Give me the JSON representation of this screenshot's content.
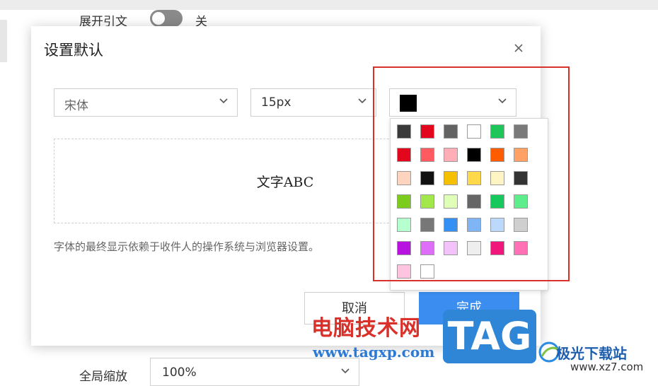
{
  "background": {
    "expand_quote_label": "展开引文",
    "expand_quote_state": "关",
    "global_zoom_label": "全局缩放",
    "global_zoom_value": "100%"
  },
  "dialog": {
    "title": "设置默认",
    "font_family": "宋体",
    "font_size": "15px",
    "selected_color": "#000000",
    "preview_text": "文字ABC",
    "note": "字体的最终显示依赖于收件人的操作系统与浏览器设置。",
    "cancel_label": "取消",
    "done_label": "完成"
  },
  "color_palette": [
    [
      "#3a3a3a",
      "#e3071e",
      "#636363",
      "#ffffff",
      "#1ec65a",
      "#7a7a7a"
    ],
    [
      "#e3071e",
      "#ff5a5f",
      "#ffadb7",
      "#000000",
      "#ff5b00",
      "#ffa165"
    ],
    [
      "#ffd4bf",
      "#111111",
      "#f5c000",
      "#ffd94a",
      "#fff4c4",
      "#333333"
    ],
    [
      "#7ccc1e",
      "#a3e84b",
      "#dfffb8",
      "#666666",
      "#17c85c",
      "#5eed8b"
    ],
    [
      "#b6ffcf",
      "#777777",
      "#3490f3",
      "#7fb4f5",
      "#bcd9fb",
      "#cfcfcf"
    ],
    [
      "#b712e0",
      "#de6df7",
      "#f3c2fb",
      "#eeeeee",
      "#f0167b",
      "#ff71b4"
    ],
    [
      "#ffc4e0",
      "#ffffff"
    ]
  ],
  "watermarks": {
    "cn_site": "电脑技术网",
    "url": "www.tagxp.com",
    "tag": "TAG",
    "jiguang": "极光下载站",
    "xz7": "www.xz7.com"
  }
}
